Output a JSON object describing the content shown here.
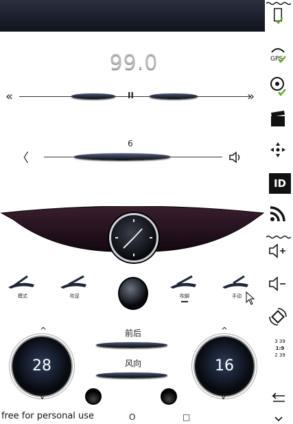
{
  "topbar": {},
  "radio": {
    "frequency": "99.0",
    "prev_symbol": "«",
    "pause_symbol": "II",
    "next_symbol": "»"
  },
  "volume": {
    "level": "6",
    "left_symbol": "〈",
    "speaker_symbol": "🔈"
  },
  "modes": [
    {
      "label": "模式",
      "active": false
    },
    {
      "label": "吹足",
      "active": false
    },
    {
      "label": "吹脚",
      "active": true
    },
    {
      "label": "手动",
      "active": false
    }
  ],
  "climate": {
    "left_temp": "28",
    "right_temp": "16",
    "up_symbol": "^",
    "down_symbol": "v",
    "rear_label": "前后",
    "fan_label": "风向"
  },
  "sidebar": {
    "icons": [
      "battery-icon",
      "gps-icon",
      "camera-icon",
      "clapperboard-icon",
      "dpad-icon",
      "id-icon",
      "rss-icon",
      "volume-up-icon",
      "volume-down-icon",
      "rotate-icon",
      "time-icon",
      "back-icon"
    ],
    "id_label": "ID",
    "time_lines": [
      "3 39",
      "1:9",
      "2 39"
    ]
  },
  "footer": {
    "watermark": "free for personal use",
    "home_symbol": "O",
    "recent_symbol": "□"
  }
}
